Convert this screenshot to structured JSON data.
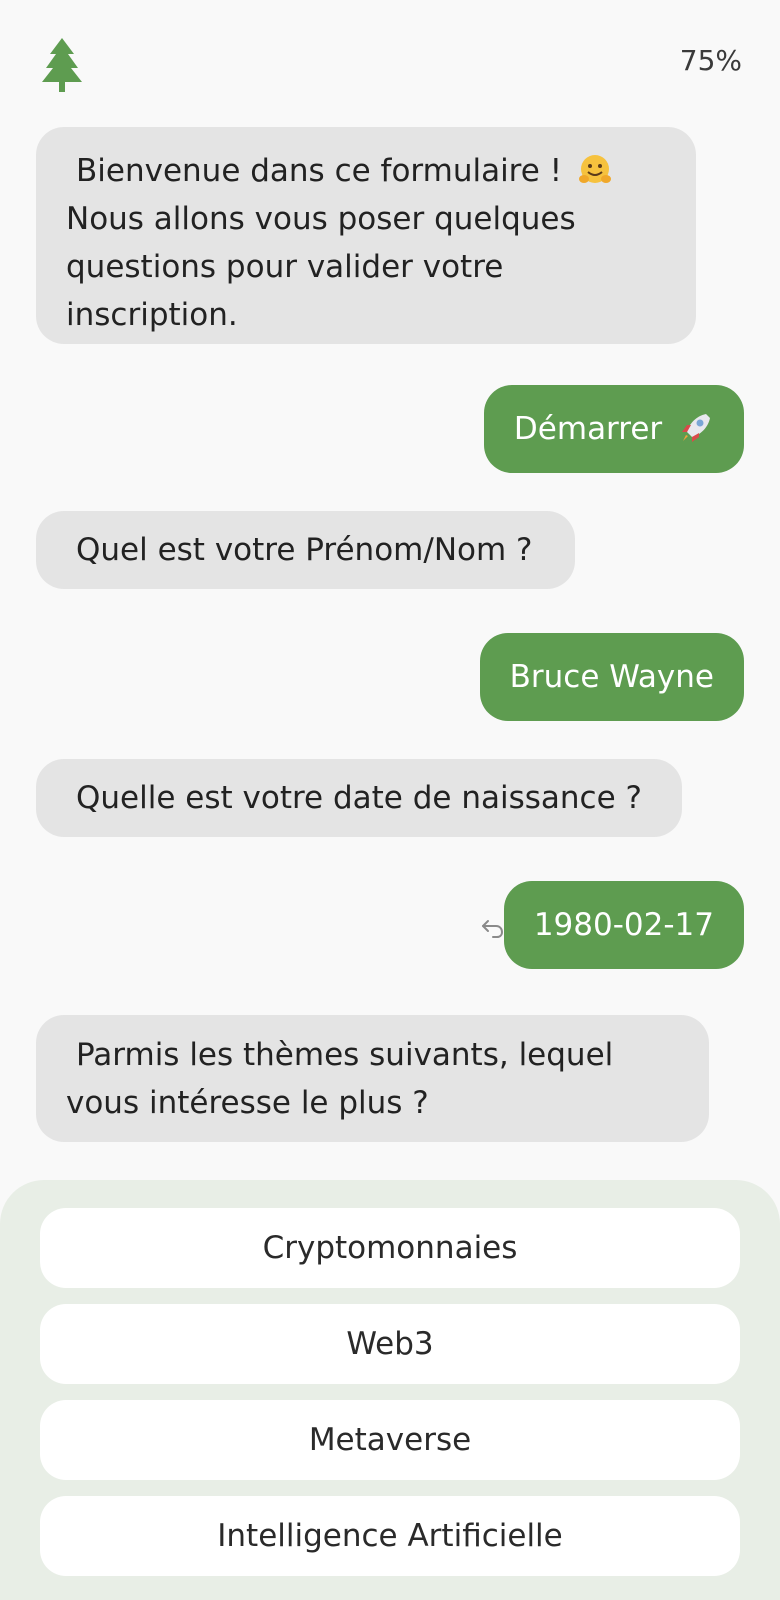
{
  "header": {
    "logo_icon": "tree-icon",
    "progress": "75%"
  },
  "messages": [
    {
      "role": "bot",
      "text": "Bienvenue dans ce formulaire !",
      "text2": "Nous allons vous poser quelques questions pour valider votre inscription.",
      "emoji_icon": "hugging-face-emoji"
    },
    {
      "role": "user",
      "text": "Démarrer",
      "emoji_icon": "rocket-emoji"
    },
    {
      "role": "bot",
      "text": "Quel est votre Prénom/Nom ?"
    },
    {
      "role": "user",
      "text": "Bruce Wayne"
    },
    {
      "role": "bot",
      "text": "Quelle est votre date de naissance ?"
    },
    {
      "role": "user",
      "text": "1980-02-17",
      "action_icon": "undo-icon"
    },
    {
      "role": "bot",
      "text": "Parmis les thèmes suivants, lequel vous intéresse le plus ?"
    }
  ],
  "choices": [
    "Cryptomonnaies",
    "Web3",
    "Metaverse",
    "Intelligence Artificielle"
  ],
  "colors": {
    "accent": "#5e9c50",
    "bot_bubble": "#e4e4e4",
    "choice_panel": "#e8eee6",
    "background": "#f9f9f9"
  }
}
